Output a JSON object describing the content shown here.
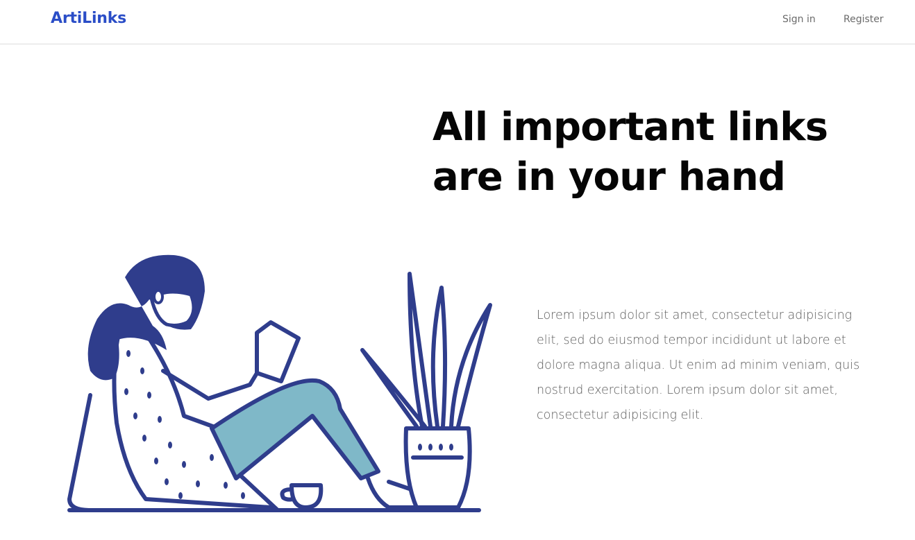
{
  "navbar": {
    "brand": "ArtiLinks",
    "links": [
      {
        "label": "Sign in"
      },
      {
        "label": "Register"
      }
    ]
  },
  "hero": {
    "headline_line1": "All important links",
    "headline_line2": "are in your hand",
    "description": "Lorem ipsum dolor sit amet, consectetur adipisicing elit, sed do eiusmod tempor incididunt ut labore et dolore magna aliqua. Ut enim ad minim veniam, quis nostrud exercitation. Lorem ipsum dolor sit amet, consectetur adipisicing elit."
  },
  "colors": {
    "brand": "#2a4dc7",
    "ink": "#2f3d8c",
    "pants": "#7fb8c8"
  }
}
